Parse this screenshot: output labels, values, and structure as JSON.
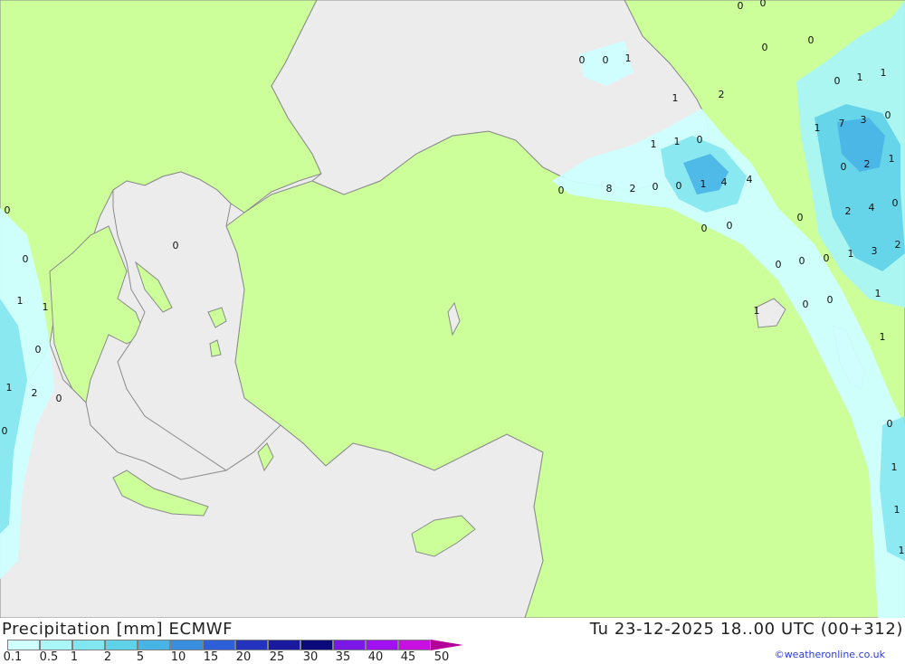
{
  "header": {
    "title": "Precipitation [mm] ECMWF",
    "validity": "Tu 23-12-2025 18..00 UTC (00+312)",
    "credit": "©weatheronline.co.uk"
  },
  "legend": {
    "colors": [
      "#cfffff",
      "#aaf5f5",
      "#82e6f0",
      "#5fd2e8",
      "#48b4e6",
      "#3a8ee0",
      "#2e5fd8",
      "#2432c0",
      "#1a1aa0",
      "#0a0a7a",
      "#7b18e8",
      "#a010f0",
      "#c810e0",
      "#e81ad8",
      "#c0189e",
      "#b30099"
    ],
    "labels": [
      "0.1",
      "0.5",
      "1",
      "2",
      "5",
      "10",
      "15",
      "20",
      "25",
      "30",
      "35",
      "40",
      "45",
      "50"
    ]
  },
  "map": {
    "land_color": "#ccff99",
    "sea_color": "#ececec",
    "values": [
      "0",
      "0",
      "0",
      "0",
      "0",
      "0",
      "1",
      "1",
      "0",
      "1",
      "1",
      "2",
      "3",
      "7",
      "1",
      "0",
      "1",
      "1",
      "0",
      "1",
      "2",
      "0",
      "2",
      "8",
      "0",
      "1",
      "0",
      "4",
      "4",
      "0",
      "0",
      "2",
      "4",
      "0",
      "0",
      "0",
      "0",
      "0",
      "1",
      "3",
      "2",
      "0",
      "1",
      "0",
      "0",
      "1",
      "0",
      "0",
      "1",
      "1",
      "0",
      "1",
      "2",
      "0",
      "0",
      "1",
      "0",
      "1",
      "1",
      "1",
      "0"
    ]
  }
}
